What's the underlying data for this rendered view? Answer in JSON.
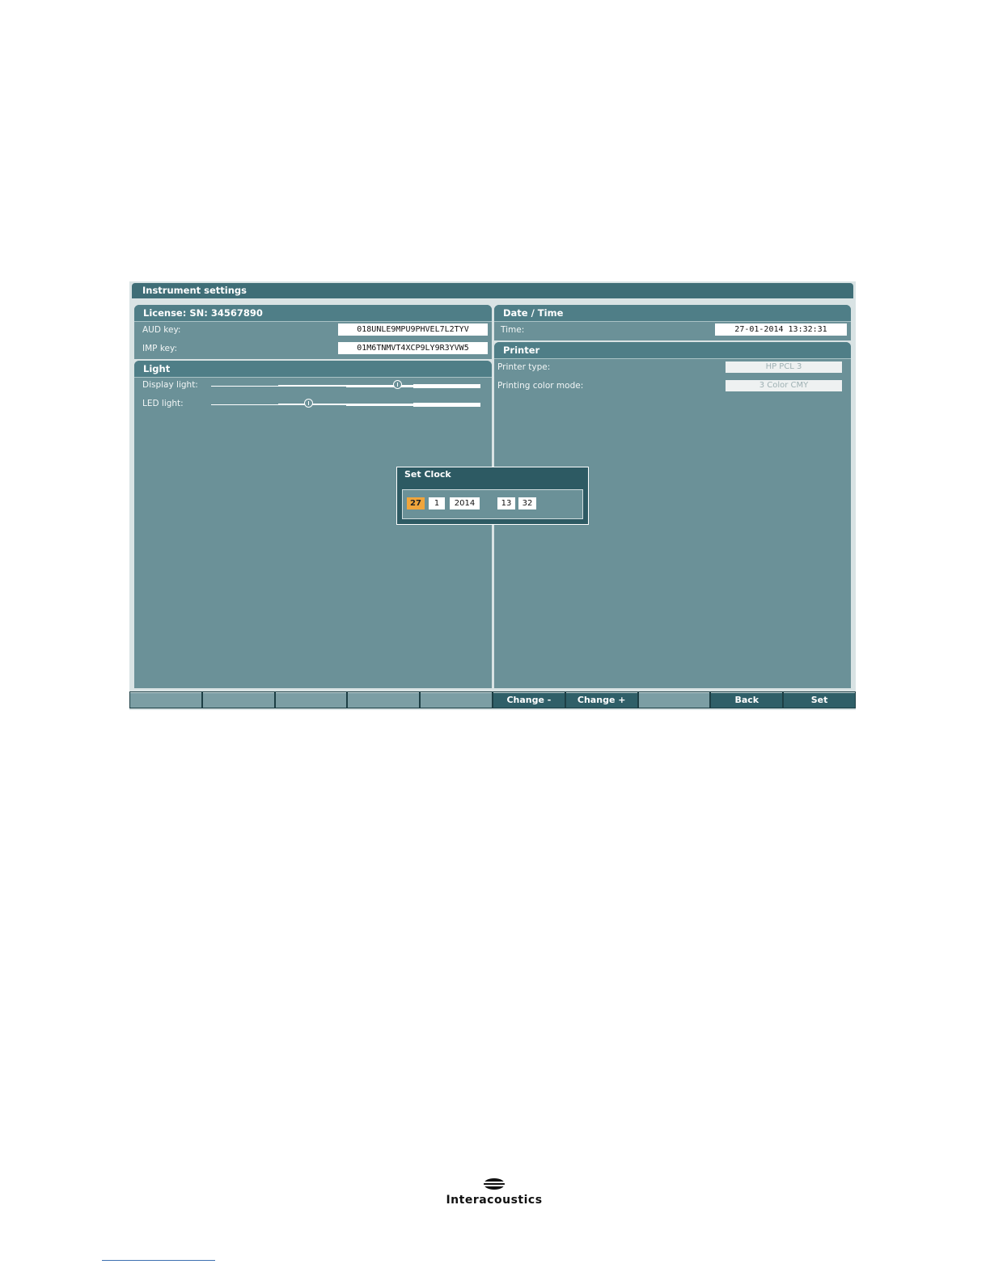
{
  "window": {
    "title": "Instrument settings"
  },
  "license": {
    "heading": "License: SN: 34567890",
    "aud_label": "AUD key:",
    "aud_value": "018UNLE9MPU9PHVEL7L2TYV",
    "imp_label": "IMP key:",
    "imp_value": "01M6TNMVT4XCP9LY9R3YVW5"
  },
  "datetime": {
    "heading": "Date / Time",
    "time_label": "Time:",
    "time_value": "27-01-2014 13:32:31"
  },
  "printer": {
    "heading": "Printer",
    "type_label": "Printer type:",
    "type_value": "HP PCL 3",
    "mode_label": "Printing color mode:",
    "mode_value": "3 Color CMY"
  },
  "light": {
    "heading": "Light",
    "display_label": "Display light:",
    "display_level": 0.69,
    "led_label": "LED light:",
    "led_level": 0.36
  },
  "set_clock": {
    "title": "Set Clock",
    "day": "27",
    "month": "1",
    "year": "2014",
    "hour": "13",
    "minute": "32",
    "selected": "day"
  },
  "softkeys": [
    "",
    "",
    "",
    "",
    "",
    "Change -",
    "Change +",
    "",
    "Back",
    "Set"
  ],
  "logo": {
    "text": "Interacoustics"
  },
  "colors": {
    "panel": "#6b9198",
    "header": "#3f6e77",
    "selected": "#f0a53c"
  }
}
